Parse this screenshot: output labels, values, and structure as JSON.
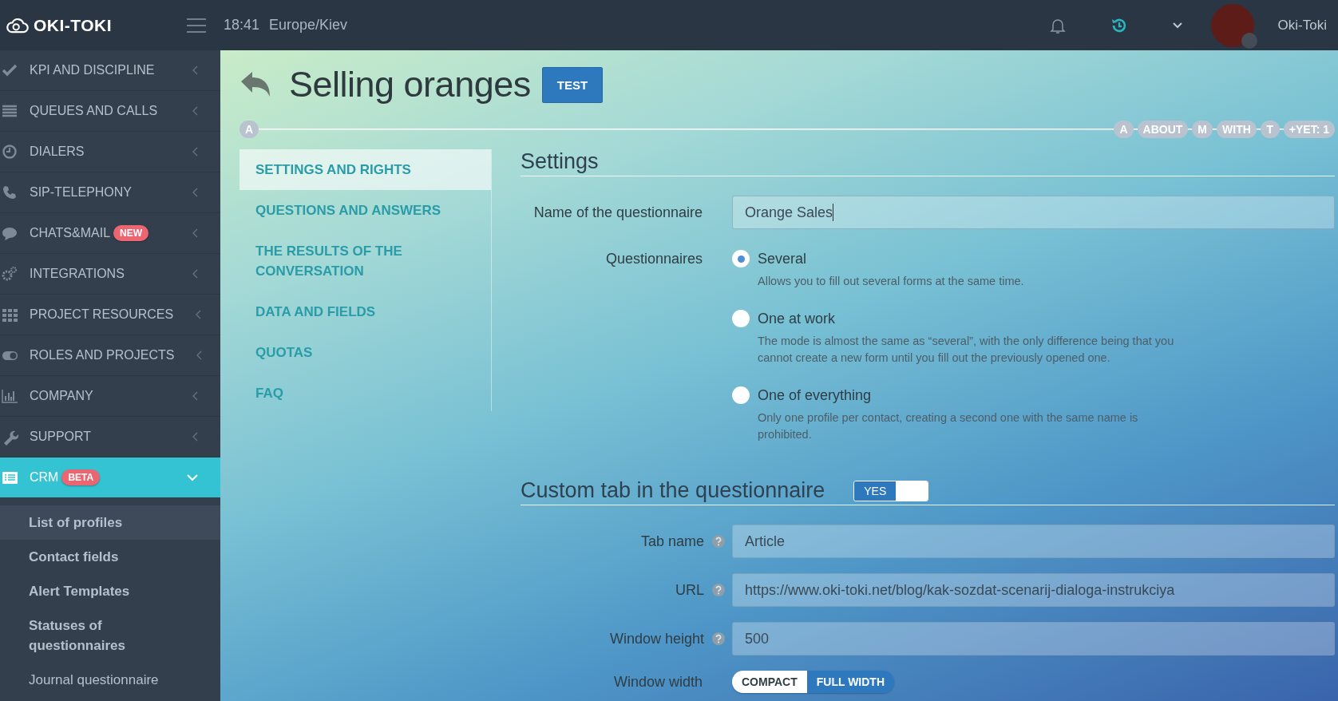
{
  "header": {
    "logo": "OKI-TOKI",
    "time": "18:41",
    "timezone": "Europe/Kiev",
    "user": "Oki-Toki"
  },
  "sidebar": {
    "items": [
      {
        "label": "KPI AND DISCIPLINE",
        "expanded": false
      },
      {
        "label": "QUEUES AND CALLS",
        "expanded": false
      },
      {
        "label": "DIALERS",
        "expanded": false
      },
      {
        "label": "SIP-TELEPHONY",
        "expanded": false
      },
      {
        "label": "CHATS&MAIL",
        "badge": "NEW",
        "expanded": false
      },
      {
        "label": "INTEGRATIONS",
        "expanded": false
      },
      {
        "label": "PROJECT RESOURCES",
        "expanded": false
      },
      {
        "label": "ROLES AND PROJECTS",
        "expanded": false
      },
      {
        "label": "COMPANY",
        "expanded": false
      },
      {
        "label": "SUPPORT",
        "expanded": false
      },
      {
        "label": "CRM",
        "badge": "BETA",
        "expanded": true,
        "children": [
          {
            "label": "List of profiles",
            "kind": "group",
            "selected": true
          },
          {
            "label": "Contact fields",
            "kind": "group",
            "selected": false
          },
          {
            "label": "Alert Templates",
            "kind": "group",
            "selected": false
          },
          {
            "label": "Statuses of questionnaires",
            "kind": "group",
            "selected": false
          },
          {
            "label": "Journal questionnaire",
            "kind": "page",
            "selected": false
          }
        ]
      }
    ]
  },
  "page": {
    "title": "Selling oranges",
    "test_button": "TEST",
    "steps_start": "A",
    "steps": [
      "A",
      "ABOUT",
      "M",
      "WITH",
      "T",
      "+YET: 1"
    ]
  },
  "nav": {
    "items": [
      {
        "label": "SETTINGS AND RIGHTS",
        "selected": true
      },
      {
        "label": "QUESTIONS AND ANSWERS",
        "selected": false
      },
      {
        "label": "THE RESULTS OF THE CONVERSATION",
        "selected": false
      },
      {
        "label": "DATA AND FIELDS",
        "selected": false
      },
      {
        "label": "QUOTAS",
        "selected": false
      },
      {
        "label": "FAQ",
        "selected": false
      }
    ]
  },
  "settings": {
    "heading": "Settings",
    "name_label": "Name of the questionnaire",
    "name_value": "Orange Sales",
    "mode_label": "Questionnaires",
    "modes": [
      {
        "label": "Several",
        "description": "Allows you to fill out several forms at the same time.",
        "selected": true
      },
      {
        "label": "One at work",
        "description": "The mode is almost the same as “several”, with the only difference being that you cannot create a new form until you fill out the previously opened one.",
        "selected": false
      },
      {
        "label": "One of everything",
        "description": "Only one profile per contact, creating a second one with the same name is prohibited.",
        "selected": false
      }
    ]
  },
  "custom_tab": {
    "heading": "Custom tab in the questionnaire",
    "toggle": {
      "label": "YES",
      "on": true
    },
    "fields": [
      {
        "label": "Tab name",
        "value": "Article"
      },
      {
        "label": "URL",
        "value": "https://www.oki-toki.net/blog/kak-sozdat-scenarij-dialoga-instrukciya"
      },
      {
        "label": "Window height",
        "value": "500"
      }
    ],
    "width_label": "Window width",
    "width_options": [
      {
        "label": "COMPACT",
        "selected": false
      },
      {
        "label": "FULL WIDTH",
        "selected": true
      }
    ]
  }
}
